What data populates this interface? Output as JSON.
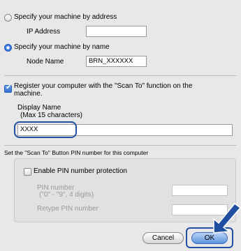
{
  "radio_address": {
    "label": "Specify your machine by address",
    "selected": false
  },
  "ip_address": {
    "label": "IP Address",
    "value": ""
  },
  "radio_name": {
    "label": "Specify your machine by name",
    "selected": true
  },
  "node_name": {
    "label": "Node Name",
    "value": "BRN_XXXXXX"
  },
  "register": {
    "label_line1": "Register your computer with the \"Scan To\" function on the",
    "label_line2": "machine.",
    "checked": true
  },
  "display_name": {
    "label": "Display Name",
    "hint": "(Max 15 characters)",
    "value": "XXXX"
  },
  "pin_section": {
    "caption": "Set the \"Scan To\" Button PIN number for this computer"
  },
  "enable_pin": {
    "label": "Enable PIN number protection",
    "checked": false
  },
  "pin_number": {
    "label": "PIN number",
    "hint": "(\"0\" - \"9\", 4 digits)",
    "value": ""
  },
  "retype_pin": {
    "label": "Retype PIN number",
    "value": ""
  },
  "buttons": {
    "cancel": "Cancel",
    "ok": "OK"
  },
  "colors": {
    "highlight": "#1f4f9e",
    "arrow": "#1f4f9e"
  }
}
